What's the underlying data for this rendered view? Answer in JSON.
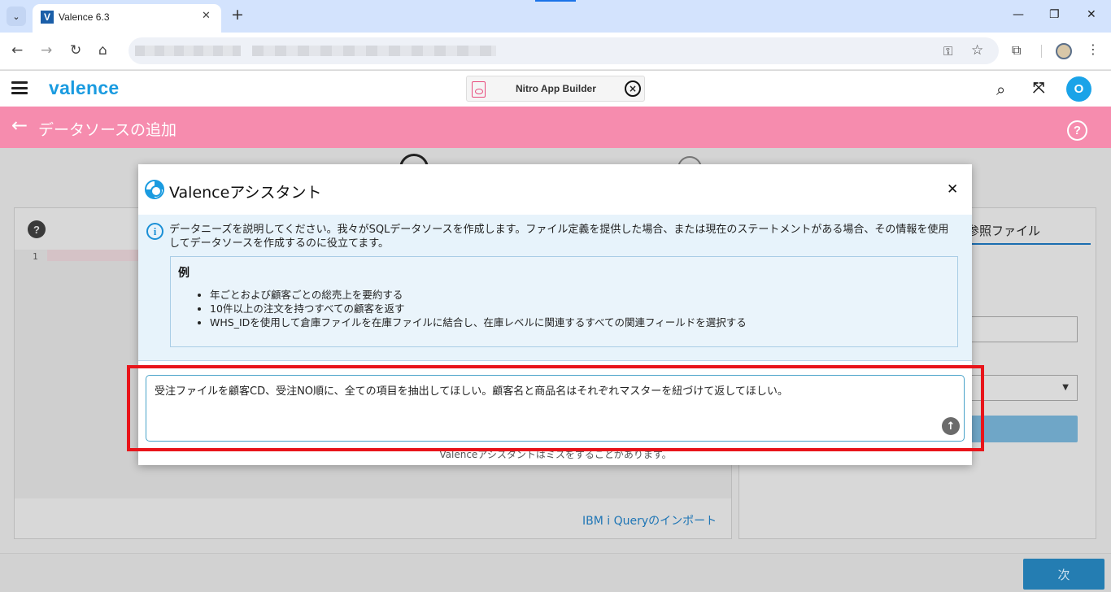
{
  "browser": {
    "tab_title": "Valence 6.3",
    "tab_favicon": "V",
    "tab_close": "✕",
    "new_tab": "+",
    "tab_menu": "⌄",
    "minimize": "—",
    "restore": "❐",
    "close": "✕",
    "back": "←",
    "forward": "→",
    "reload": "↻",
    "home": "⌂",
    "key_icon": "⚿",
    "star_icon": "☆",
    "extensions_icon": "⧉",
    "more_icon": "⋮"
  },
  "app": {
    "logo": "valence",
    "nitro_label": "Nitro App Builder",
    "nitro_close": "×",
    "search_icon": "⌕",
    "expand_icon": "⤧",
    "user_initial": "O"
  },
  "page": {
    "back_arrow": "←",
    "title": "データソースの追加",
    "help": "?"
  },
  "background": {
    "left_help": "?",
    "line_number": "1",
    "import_link": "IBM i Queryのインポート",
    "ref_tab": "参照ファイル",
    "select_arrow": "▼",
    "next_button": "次"
  },
  "dialog": {
    "title": "Valenceアシスタント",
    "close": "✕",
    "info_icon": "i",
    "info_text": "データニーズを説明してください。我々がSQLデータソースを作成します。ファイル定義を提供した場合、または現在のステートメントがある場合、その情報を使用してデータソースを作成するのに役立てます。",
    "example_heading": "例",
    "examples": [
      "年ごとおよび顧客ごとの総売上を要約する",
      "10件以上の注文を持つすべての顧客を返す",
      "WHS_IDを使用して倉庫ファイルを在庫ファイルに結合し、在庫レベルに関連するすべての関連フィールドを選択する"
    ],
    "input_value": "受注ファイルを顧客CD、受注NO順に、全ての項目を抽出してほしい。顧客名と商品名はそれぞれマスターを紐づけて返してほしい。",
    "send_icon": "↑",
    "disclaimer": "Valenceアシスタントはミスをすることがあります。"
  },
  "colors": {
    "brand": "#1a9be0",
    "title_bar": "#f68cae",
    "highlight": "#e8141a"
  }
}
